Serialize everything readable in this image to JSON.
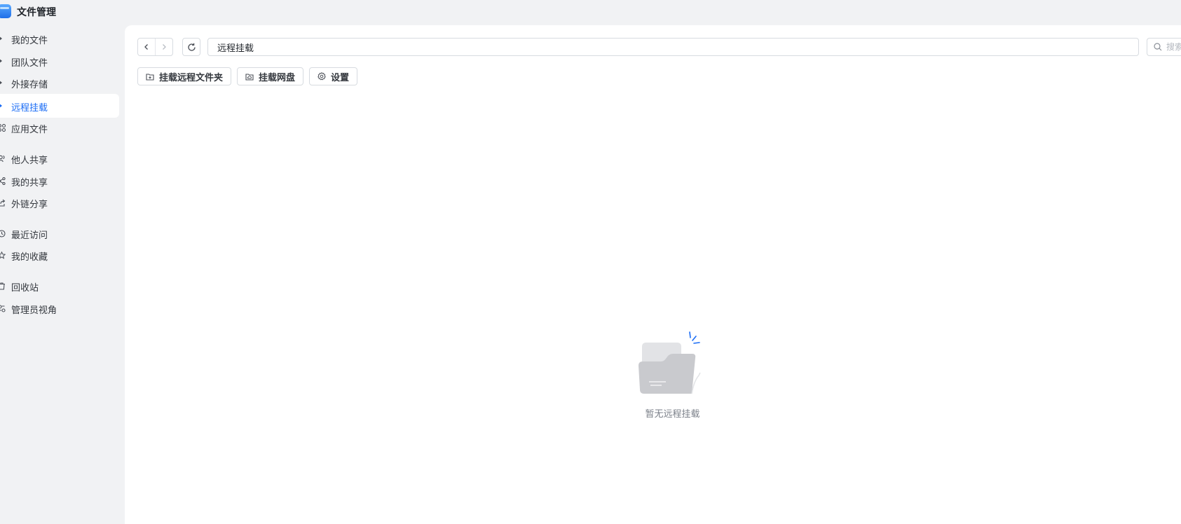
{
  "app": {
    "title": "文件管理"
  },
  "sidebar": {
    "items": [
      {
        "label": "我的文件",
        "icon": "caret-right-icon",
        "active": false
      },
      {
        "label": "团队文件",
        "icon": "caret-right-icon",
        "active": false
      },
      {
        "label": "外接存储",
        "icon": "caret-right-icon",
        "active": false
      },
      {
        "label": "远程挂载",
        "icon": "caret-right-icon",
        "active": true
      },
      {
        "label": "应用文件",
        "icon": "apps-icon",
        "active": false
      },
      {
        "label": "他人共享",
        "icon": "users-icon",
        "active": false
      },
      {
        "label": "我的共享",
        "icon": "share-icon",
        "active": false
      },
      {
        "label": "外链分享",
        "icon": "external-link-icon",
        "active": false
      },
      {
        "label": "最近访问",
        "icon": "clock-icon",
        "active": false
      },
      {
        "label": "我的收藏",
        "icon": "star-icon",
        "active": false
      },
      {
        "label": "回收站",
        "icon": "trash-icon",
        "active": false
      },
      {
        "label": "管理员视角",
        "icon": "admin-icon",
        "active": false
      }
    ]
  },
  "path": {
    "current": "远程挂载"
  },
  "search": {
    "placeholder": "搜索"
  },
  "toolbar": {
    "mount_folder": "挂载远程文件夹",
    "mount_drive": "挂载网盘",
    "settings": "设置"
  },
  "empty_state": {
    "message": "暂无远程挂载"
  },
  "colors": {
    "accent": "#1a6cf5",
    "sidebar_bg": "#f1f2f4",
    "panel_bg": "#ffffff"
  }
}
